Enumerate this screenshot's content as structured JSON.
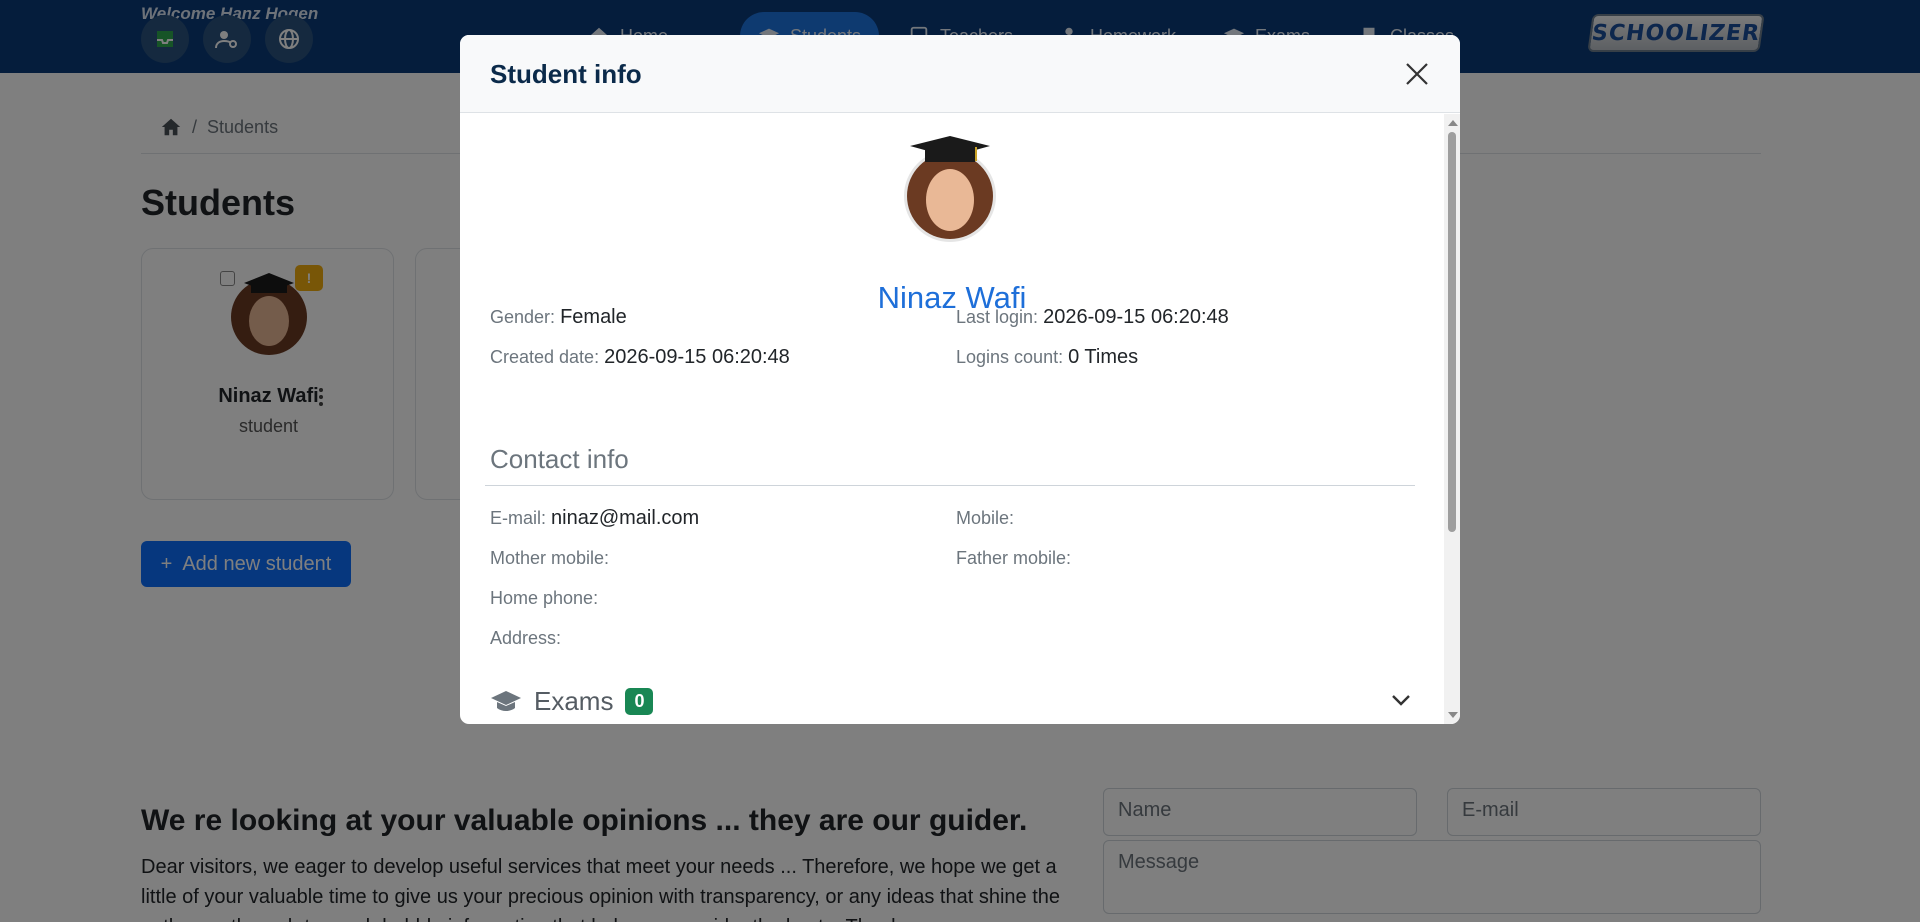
{
  "header": {
    "welcome": "Welcome Hanz Hogen",
    "nav": [
      {
        "label": "Home",
        "icon": "home-icon"
      },
      {
        "label": "Students",
        "icon": "graduation-cap-icon",
        "active": true
      },
      {
        "label": "Teachers",
        "icon": "book-icon"
      },
      {
        "label": "Homework",
        "icon": "user-icon"
      },
      {
        "label": "Exams",
        "icon": "graduation-cap-icon"
      },
      {
        "label": "Classes",
        "icon": "door-icon"
      }
    ],
    "logo_text": "SCHOOLIZER"
  },
  "breadcrumb": {
    "current": "Students"
  },
  "page": {
    "title": "Students"
  },
  "students": [
    {
      "name": "Ninaz Wafi",
      "role": "student",
      "badge": "!"
    }
  ],
  "buttons": {
    "add_student": "Add new student"
  },
  "feedback": {
    "title": "We re looking at your valuable opinions ... they are our guider.",
    "text": "Dear visitors, we eager to develop useful services that meet your needs ... Therefore, we hope we get a little of your valuable time to give us your precious opinion with transparency, or any ideas that shine the pathways through to reach bubble information that helps us consider the best... Thank you",
    "name_placeholder": "Name",
    "email_placeholder": "E-mail",
    "message_placeholder": "Message"
  },
  "modal": {
    "title": "Student info",
    "student_name": "Ninaz Wafi",
    "fields": {
      "gender_label": "Gender:",
      "gender": "Female",
      "last_login_label": "Last login:",
      "last_login": "2026-09-15 06:20:48",
      "created_label": "Created date:",
      "created": "2026-09-15 06:20:48",
      "logins_label": "Logins count:",
      "logins": "0 Times"
    },
    "contact": {
      "title": "Contact info",
      "email_label": "E-mail:",
      "email": "ninaz@mail.com",
      "mobile_label": "Mobile:",
      "mobile": "",
      "mother_label": "Mother mobile:",
      "mother": "",
      "father_label": "Father mobile:",
      "father": "",
      "home_label": "Home phone:",
      "home": "",
      "address_label": "Address:",
      "address": ""
    },
    "exams": {
      "label": "Exams",
      "count": "0"
    }
  },
  "colors": {
    "header_bg": "#0b3b78",
    "primary": "#0d6efd",
    "active_nav": "#1d74e0",
    "badge_warning": "#f0ad0e",
    "badge_success": "#198754",
    "name_link": "#1e6fd9"
  }
}
